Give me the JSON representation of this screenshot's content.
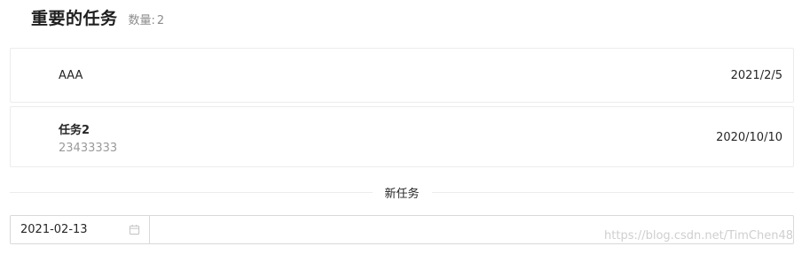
{
  "header": {
    "title": "重要的任务",
    "count_label": "数量:",
    "count_value": "2"
  },
  "tasks": [
    {
      "name": "AAA",
      "description": "",
      "date": "2021/2/5"
    },
    {
      "name": "任务2",
      "description": "23433333",
      "date": "2020/10/10"
    }
  ],
  "new_task": {
    "divider_label": "新任务",
    "date_value": "2021-02-13",
    "input_value": "",
    "input_placeholder": ""
  },
  "watermark": "https://blog.csdn.net/TimChen48",
  "icons": {
    "date_picker": "calendar-icon"
  },
  "colors": {
    "border": "#ececec",
    "input_border": "#d9d9d9",
    "muted_text": "#8c8c8c"
  }
}
